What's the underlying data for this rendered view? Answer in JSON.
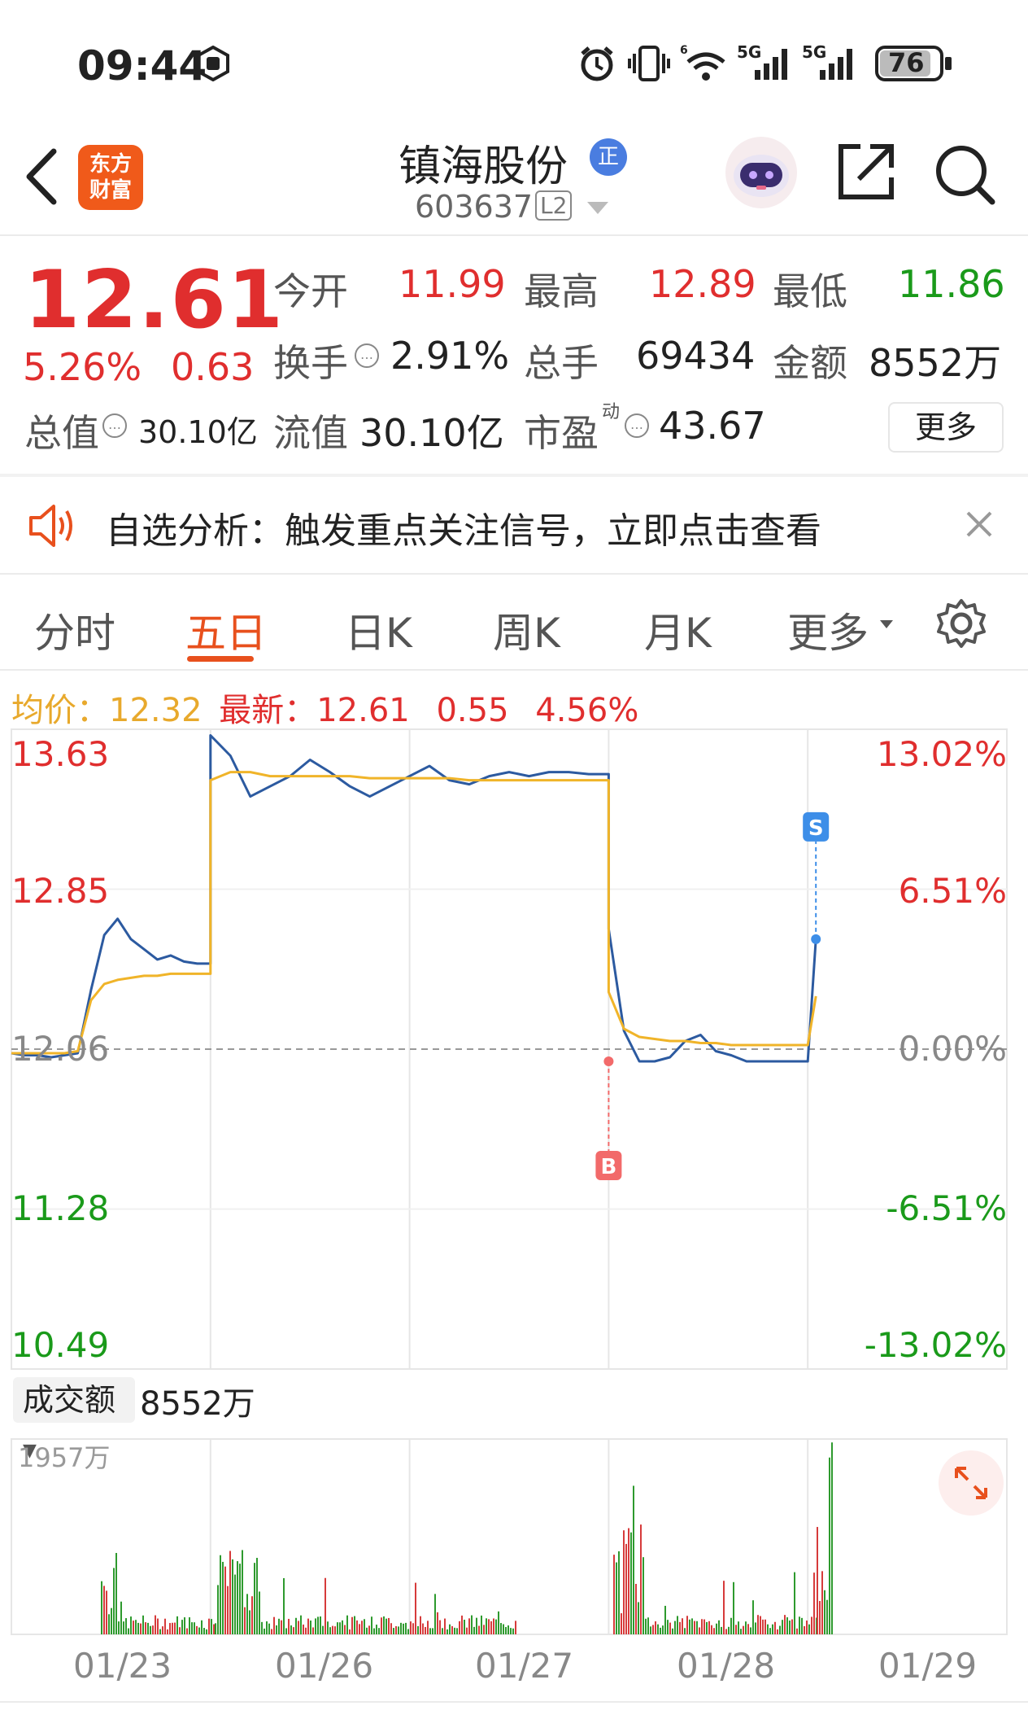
{
  "status_bar": {
    "time": "09:44",
    "network_1": "5G",
    "network_2": "5G",
    "battery": "76"
  },
  "header": {
    "logo_text": "东方\n财富",
    "stock_name": "镇海股份",
    "badge": "正",
    "stock_code": "603637",
    "level_badge": "L2"
  },
  "quote": {
    "price": "12.61",
    "change_pct": "5.26%",
    "change": "0.63",
    "open_label": "今开",
    "open": "11.99",
    "high_label": "最高",
    "high": "12.89",
    "low_label": "最低",
    "low": "11.86",
    "turnover_label": "换手",
    "turnover": "2.91%",
    "volume_label": "总手",
    "volume": "69434",
    "amount_label": "金额",
    "amount": "8552万",
    "mcap_label": "总值",
    "mcap": "30.10亿",
    "float_label": "流值",
    "float_value": "30.10亿",
    "pe_label": "市盈",
    "pe_sup": "动",
    "pe": "43.67",
    "more_button": "更多"
  },
  "notice": {
    "text": "自选分析：触发重点关注信号，立即点击查看"
  },
  "tabs": [
    {
      "label": "分时"
    },
    {
      "label": "五日"
    },
    {
      "label": "日K"
    },
    {
      "label": "周K"
    },
    {
      "label": "月K"
    },
    {
      "label": "更多"
    }
  ],
  "chart_info": {
    "avg_label": "均价：",
    "avg_value": "12.32",
    "latest_label": "最新：",
    "latest_value": "12.61",
    "latest_change": "0.55",
    "latest_pct": "4.56%"
  },
  "colors": {
    "up": "#e02e2e",
    "down": "#1a9a1a",
    "accent": "#e8501d",
    "price_line": "#2c5aa0",
    "avg_line": "#f0b429",
    "buy_marker": "#f26a6a",
    "sell_marker": "#3d8ee8"
  },
  "chart_data": {
    "type": "line",
    "x": [
      "01/23",
      "01/26",
      "01/27",
      "01/28",
      "01/29"
    ],
    "ylim": [
      10.49,
      13.63
    ],
    "y_ticks_left": [
      "13.63",
      "12.85",
      "12.06",
      "11.28",
      "10.49"
    ],
    "y_ticks_right": [
      "13.02%",
      "6.51%",
      "0.00%",
      "-6.51%",
      "-13.02%"
    ],
    "reference_price": 12.06,
    "grid": true,
    "series": [
      {
        "values": [
          12.04,
          12.03,
          12.03,
          12.02,
          12.03,
          12.04,
          12.35,
          12.62,
          12.7,
          12.6,
          12.55,
          12.5,
          12.52,
          12.49,
          12.48,
          12.48,
          13.6,
          13.5,
          13.3,
          13.35,
          13.4,
          13.48,
          13.42,
          13.35,
          13.3,
          13.35,
          13.4,
          13.45,
          13.38,
          13.36,
          13.4,
          13.42,
          13.4,
          13.42,
          13.42,
          13.41,
          13.41,
          12.65,
          12.15,
          12.0,
          12.0,
          12.02,
          12.1,
          12.13,
          12.05,
          12.03,
          12.0,
          12.0,
          12.0,
          12.0,
          12.0,
          12.6
        ]
      },
      {
        "values": [
          12.04,
          12.04,
          12.04,
          12.04,
          12.04,
          12.05,
          12.3,
          12.38,
          12.4,
          12.41,
          12.42,
          12.42,
          12.43,
          12.43,
          12.43,
          12.43,
          13.38,
          13.42,
          13.42,
          13.4,
          13.4,
          13.4,
          13.4,
          13.4,
          13.39,
          13.39,
          13.39,
          13.39,
          13.39,
          13.38,
          13.38,
          13.38,
          13.38,
          13.38,
          13.38,
          13.38,
          13.38,
          12.34,
          12.16,
          12.12,
          12.11,
          12.1,
          12.1,
          12.09,
          12.09,
          12.08,
          12.08,
          12.08,
          12.08,
          12.08,
          12.08,
          12.32
        ]
      }
    ],
    "markers": [
      {
        "label": "B",
        "day": "01/28"
      },
      {
        "label": "S",
        "day": "01/29"
      }
    ],
    "volume": {
      "label": "成交额",
      "total": "8552万",
      "max_label": "1957万"
    }
  }
}
